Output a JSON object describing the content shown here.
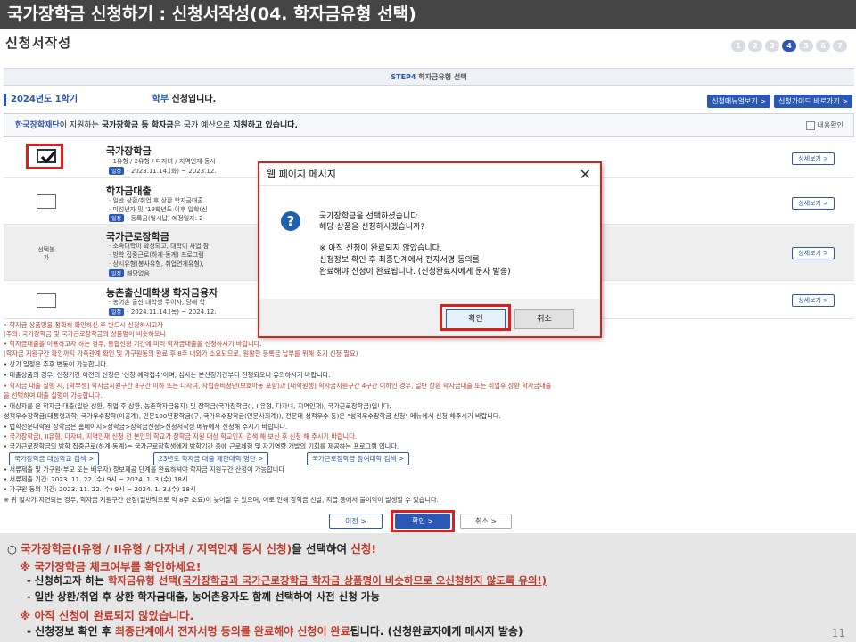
{
  "title": "국가장학금 신청하기 : 신청서작성(04. 학자금유형 선택)",
  "page_heading": "신청서작성",
  "steps": [
    "1",
    "2",
    "3",
    "4",
    "5",
    "6",
    "7"
  ],
  "active_step": "4",
  "step_bar": {
    "prefix": "STEP4",
    "label": "학자금유형 선택"
  },
  "term": {
    "year": "2024년도 1학기",
    "level": "학부",
    "suffix": "신청입니다."
  },
  "links": {
    "manual": "신청매뉴얼보기 >",
    "guide": "신청가이드 바로가기 >"
  },
  "notice": {
    "org": "한국장학재단",
    "t1": "이 지원하는",
    "bold1": "국가장학금 등 학자금",
    "t2": "은 국가 예산으로",
    "bold2": "지원하고 있습니다.",
    "agree_label": "내용확인"
  },
  "products": [
    {
      "title": "국가장학금",
      "lines": [
        "· 1유형 / 2유형 / 다자녀 / 지역인재 동시",
        "2023.11.14.(화) ~ 2023.12."
      ],
      "schedule": "일정",
      "detail": "상세보기 >"
    },
    {
      "title": "학자금대출",
      "lines": [
        "· 일반 상환/취업 후 상환 학자금대출",
        "· 미성년자 및 '19학년도 이후 입학(신",
        "· 등록금(일시납) 예정일자: 2"
      ],
      "schedule": "일정",
      "detail": "상세보기 >"
    },
    {
      "title": "국가근로장학금",
      "lines": [
        "· 소속대학이 확정되고, 대학이 사업 참",
        "· 방학 집중근로(하계·동계) 프로그램",
        "· 상시유형(봉사유형, 취업연계유형),",
        "해당없음"
      ],
      "schedule": "일정",
      "detail": "상세보기 >",
      "unavailable": "선택불가"
    },
    {
      "title": "농촌출신대학생 학자금융자",
      "lines": [
        "· 농어촌 출신 대학생 무이자, 당해 학",
        "2024.11.14.(목) ~ 2024.12."
      ],
      "schedule": "일정",
      "detail": "상세보기 >"
    }
  ],
  "notes": [
    "• 학자금 상품명을 정확히 확인하신 후 반드시 신청하시고자",
    "(주의: 국가장학금 및 국가근로장학금의 상품명이 비슷하오니",
    "• 학자금대출을 이용하고자 하는 경우, 통합신청 기간에 미리 학자금대출을 신청하시기 바랍니다.",
    "(학자금 지원구간 확인까지 가족관계 확인 및 가구원동의 완료 후 8주 내외가 소요되므로, 원활한 등록금 납부를 위해 조기 신청 필요)",
    "• 상기 일정은 추후 변동이 가능합니다.",
    "• 대출상품의 경우, 신청기간 이전의 신청은 '신청 예약접수'이며, 심사는 본신청기간부터 진행되오니 유의하시기 바랍니다.",
    "• 학자금 대출 실행 시, [학부생] 학자금지원구간 8구간 이하 또는 다자녀, 자립준비청년(보호아동 포함)과 [대학원생] 학자금지원구간 4구간 이하인 경우, 일반 상환 학자금대출 또는 취업후 상환 학자금대출",
    "을 선택하여 대출 실행이 가능합니다.",
    "• 대상자를 은 학자금 대출(일반 상환, 취업 후 상환, 농촌학자금융자) 및 장학금(국가장학금(I, II유형, 다자녀, 지역인재), 국가근로장학금)입니다.",
    "성적우수장학금(대통령과학, 국가우수장학(이공계), 인문100년장학금(구, 국가우수장학금(인문사회계)), 전문대 성적우수 등)은 \"성적우수장학금 신청\" 메뉴에서 신청 해주시기 바랍니다.",
    "• 법학전문대학원 장학금은 홈페이지>장학금>장학금신청>신청서작성 메뉴에서 신청해 주시기 바랍니다.",
    "• 국가장학금I, II유형, 다자녀, 지역인재 신청 전 본인의 학교가 장학금 지원 대상 학교인지 검색 해 보신 후 신청 해 주시기 바랍니다.",
    "• 국가근로장학금의 방학 집중근로(하계·동계)는 국가근로장학생에게 방학기간 중에 근로체험 및 자기역량 개발의 기회를 제공하는 프로그램 입니다.",
    "• 서류제출 및 가구원(부모 또는 배우자) 정보제공 단계를 완료하셔야 학자금 지원구간 산정이 가능합니다",
    "• 서류제출 기간: 2023. 11. 22.(수) 9시 ~ 2024. 1. 3.(수) 18시",
    "• 가구원 동의 기간: 2023. 11. 22.(수) 9시 ~ 2024. 1. 3.(수) 18시",
    "※ 위 절차가 지연되는 경우, 학자금 지원구간 산정(일반적으로 약 8주 소요)이 늦어질 수 있으며, 이로 인해 장학금 선발, 지급 등에서 불이익이 발생할 수 있습니다."
  ],
  "search_buttons": [
    "국가장학금 대상학교 검색 >",
    "23년도 학자금 대출 제한대학 명단 >",
    "국가근로장학금 참여대학 검색 >"
  ],
  "nav": {
    "prev": "이전 >",
    "ok": "확인 >",
    "cancel": "취소 >"
  },
  "dialog": {
    "title": "웹 페이지 메시지",
    "close": "✕",
    "icon": "?",
    "lines": [
      "국가장학금을 선택하셨습니다.",
      "해당 상품을 신청하시겠습니까?",
      "※ 아직 신청이 완료되지 않았습니다.",
      "신청정보 확인 후 최종단계에서 전자서명 동의를",
      "완료해야 신청이 완료됩니다. (신청완료자에게 문자 발송)"
    ],
    "ok": "확인",
    "cancel": "취소"
  },
  "bottom": {
    "l1_a": "○ ",
    "l1_b": "국가장학금(I유형 / II유형 / 다자녀 / 지역인재 동시 신청)",
    "l1_c": "을 선택하여 ",
    "l1_d": "신청!",
    "l2": "※ 국가장학금 체크여부를 확인하세요!",
    "l3_a": "- 신청하고자 하는 ",
    "l3_b": "학자금유형 선택",
    "l3_c": "(국가장학금과 국가근로장학금 학자금 상품명이 비슷하므로 오신청하지 않도록 유의!)",
    "l4": "- 일반 상환/취업 후 상환 학자금대출, 농어촌융자도 함께 선택하여 사전 신청 가능",
    "l5": "※ 아직 신청이 완료되지 않았습니다.",
    "l6_a": "- 신청정보 확인 후 ",
    "l6_b": "최종단계에서 전자서명 동의를 완료해야 신청이 완료",
    "l6_c": "됩니다. (신청완료자에게 메시지 발송)"
  },
  "page_number": "11",
  "colors": {
    "accent": "#2b57b5",
    "highlight": "#d8201f",
    "note_red": "#c0392b"
  }
}
